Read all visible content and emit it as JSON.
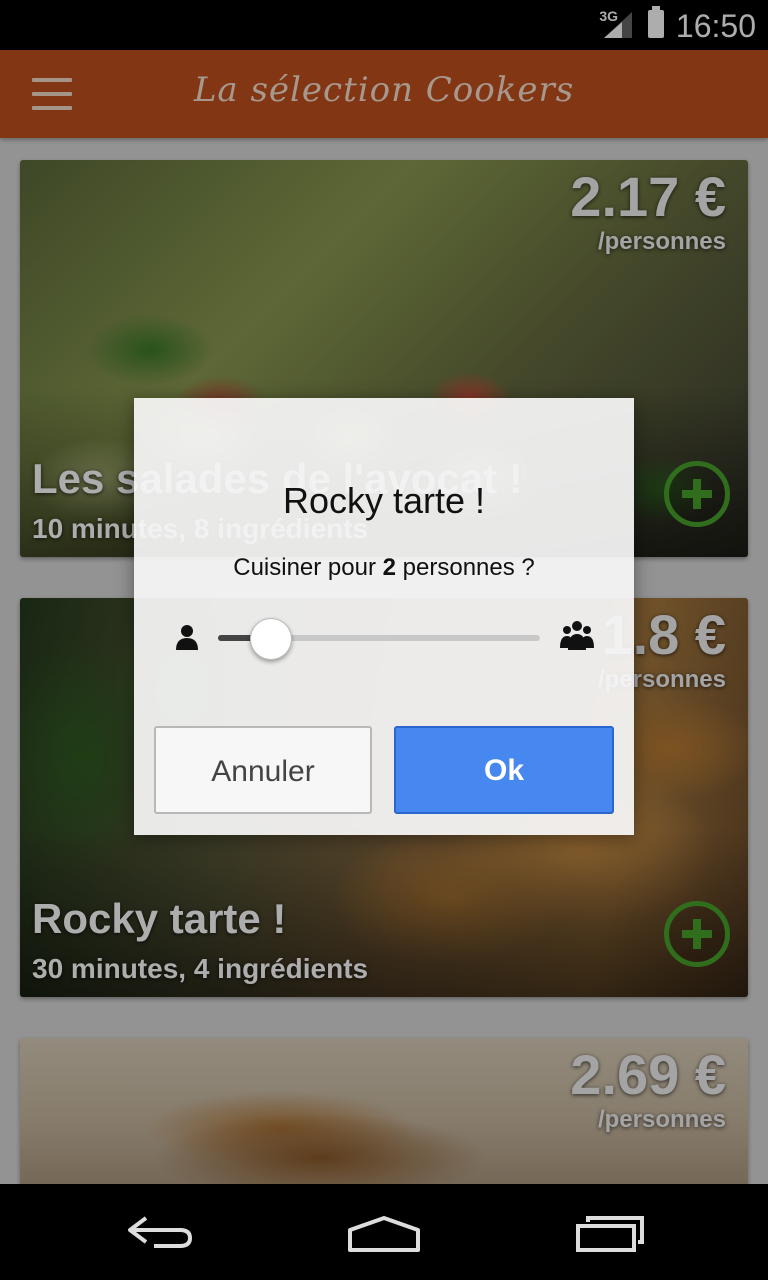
{
  "status_bar": {
    "network": "3G",
    "time": "16:50"
  },
  "app_bar": {
    "title": "La sélection Cookers"
  },
  "recipes": [
    {
      "title": "Les salades de l'avocat !",
      "meta": "10 minutes, 8 ingrédients",
      "price": "2.17 €",
      "per": "/personnes"
    },
    {
      "title": "Rocky tarte !",
      "meta": "30 minutes, 4 ingrédients",
      "price": "1.8 €",
      "per": "/personnes"
    },
    {
      "title": "",
      "meta": "",
      "price": "2.69 €",
      "per": "/personnes"
    }
  ],
  "dialog": {
    "title": "Rocky tarte !",
    "question_prefix": "Cuisiner pour",
    "servings": "2",
    "question_suffix": "personnes ?",
    "slider_value_fraction": 0.16,
    "cancel_label": "Annuler",
    "ok_label": "Ok"
  },
  "colors": {
    "app_bar": "#c0501c",
    "add_button": "#48a22c",
    "ok_button": "#4688f0"
  },
  "icons": {
    "menu": "hamburger-icon",
    "add": "plus-circle-icon",
    "single_person": "person-icon",
    "group": "group-icon",
    "back": "back-icon",
    "home": "home-icon",
    "recents": "recents-icon"
  }
}
